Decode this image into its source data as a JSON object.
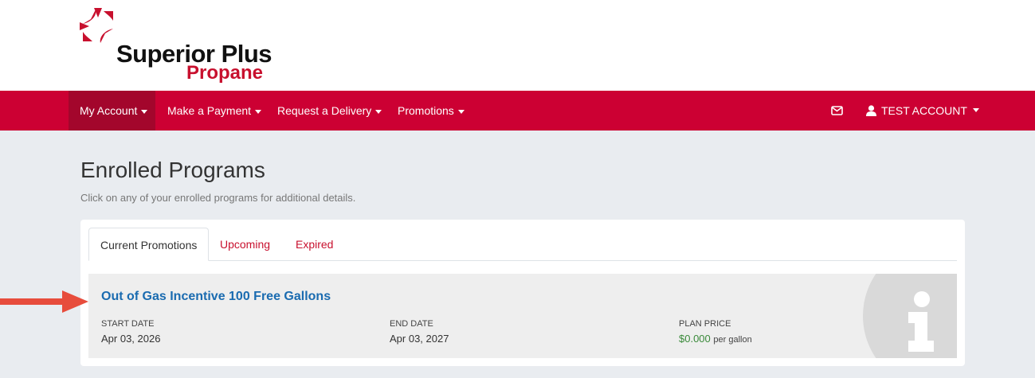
{
  "brand": {
    "name": "Superior Plus",
    "sub": "Propane",
    "colors": {
      "red": "#cc0033",
      "dark_red": "#a3062c",
      "logo_red": "#c8102e",
      "link_blue": "#1a6bb0",
      "price_green": "#3a8a3a"
    }
  },
  "nav": {
    "items": [
      {
        "label": "My Account",
        "active": true
      },
      {
        "label": "Make a Payment",
        "active": false
      },
      {
        "label": "Request a Delivery",
        "active": false
      },
      {
        "label": "Promotions",
        "active": false
      }
    ],
    "mail_icon": "envelope-icon",
    "user_icon": "user-icon",
    "account_label": "TEST ACCOUNT"
  },
  "page": {
    "title": "Enrolled Programs",
    "subtitle": "Click on any of your enrolled programs for additional details."
  },
  "tabs": [
    {
      "label": "Current Promotions",
      "active": true
    },
    {
      "label": "Upcoming",
      "active": false
    },
    {
      "label": "Expired",
      "active": false
    }
  ],
  "program": {
    "title": "Out of Gas Incentive 100 Free Gallons",
    "start_label": "START DATE",
    "start_value": "Apr 03, 2026",
    "end_label": "END DATE",
    "end_value": "Apr 03, 2027",
    "price_label": "PLAN PRICE",
    "price_value": "$0.000",
    "price_unit": "per gallon",
    "icon": "info-icon"
  }
}
